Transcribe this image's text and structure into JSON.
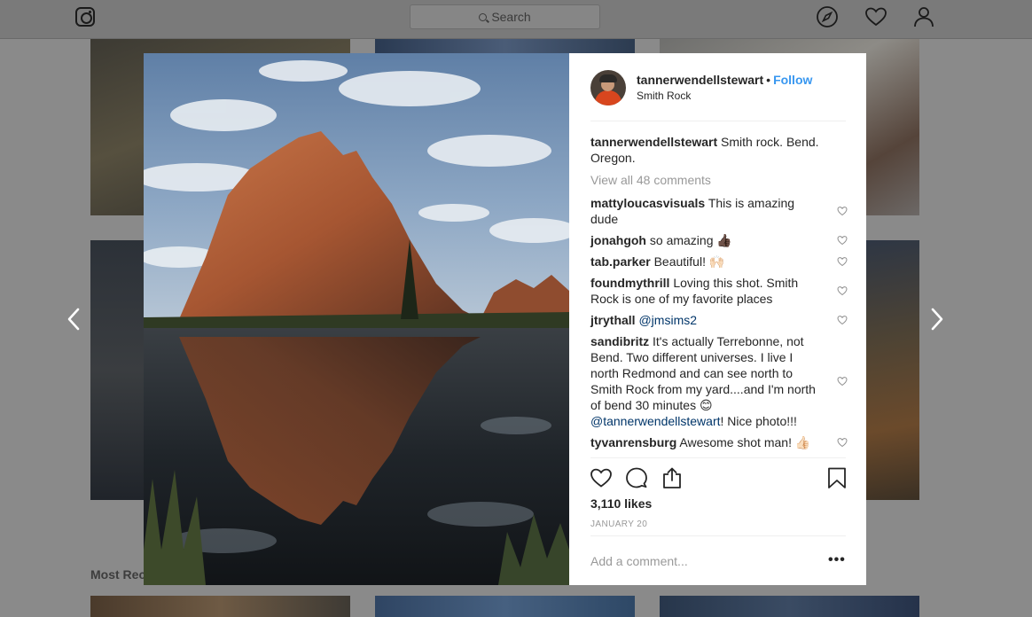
{
  "topbar": {
    "search_placeholder": "Search",
    "icons": [
      "instagram-logo-icon",
      "search-icon",
      "compass-icon",
      "heart-icon",
      "profile-icon"
    ]
  },
  "background": {
    "section_title": "Most Rec"
  },
  "post": {
    "username": "tannerwendellstewart",
    "follow_separator": "•",
    "follow_label": "Follow",
    "location": "Smith Rock",
    "caption": {
      "user": "tannerwendellstewart",
      "text": "Smith rock. Bend. Oregon."
    },
    "view_all_comments": "View all 48 comments",
    "comments": [
      {
        "user": "mattyloucasvisuals",
        "text": "This is amazing dude"
      },
      {
        "user": "jonahgoh",
        "text": "so amazing 👍🏿"
      },
      {
        "user": "tab.parker",
        "text": "Beautiful! 🙌🏻"
      },
      {
        "user": "foundmythrill",
        "text": "Loving this shot. Smith Rock is one of my favorite places"
      },
      {
        "user": "jtrythall",
        "text": "",
        "mention": "@jmsims2"
      },
      {
        "user": "sandibritz",
        "text": "It's actually Terrebonne, not Bend. Two different universes. I live I north Redmond and can see north to Smith Rock from my yard....and I'm north of bend 30 minutes 😊",
        "mention_line": "@tannerwendellstewart",
        "text_after": "! Nice photo!!!"
      },
      {
        "user": "tyvanrensburg",
        "text": "Awesome shot man! 👍🏻"
      }
    ],
    "likes": "3,110 likes",
    "date": "JANUARY 20",
    "add_comment_placeholder": "Add a comment...",
    "more_label": "•••",
    "colors": {
      "link_blue": "#3897f0",
      "mention_blue": "#003569",
      "muted": "#999999"
    }
  }
}
